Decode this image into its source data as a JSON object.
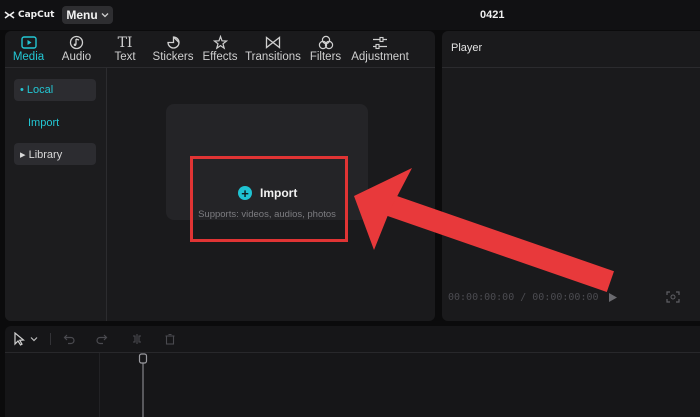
{
  "app": {
    "brand": "CapCut",
    "menu_label": "Menu",
    "project_title": "0421"
  },
  "toolbar": {
    "items": [
      {
        "label": "Media",
        "icon": "media-icon",
        "active": true
      },
      {
        "label": "Audio",
        "icon": "audio-icon"
      },
      {
        "label": "Text",
        "icon": "text-icon"
      },
      {
        "label": "Stickers",
        "icon": "stickers-icon"
      },
      {
        "label": "Effects",
        "icon": "effects-icon"
      },
      {
        "label": "Transitions",
        "icon": "transitions-icon"
      },
      {
        "label": "Filters",
        "icon": "filters-icon"
      },
      {
        "label": "Adjustment",
        "icon": "adjustment-icon"
      }
    ],
    "accent_color": "#23c7d4"
  },
  "sidebar": {
    "items": [
      {
        "label": "• Local",
        "active": true
      },
      {
        "label": "Import"
      },
      {
        "label": "▸ Library"
      }
    ]
  },
  "import_card": {
    "button_label": "Import",
    "supports_text": "Supports: videos, audios, photos",
    "highlight_color": "#e03434"
  },
  "player": {
    "title": "Player",
    "timecode": "00:00:00:00 / 00:00:00:00"
  },
  "annotation": {
    "arrow_color": "#e8393b"
  }
}
